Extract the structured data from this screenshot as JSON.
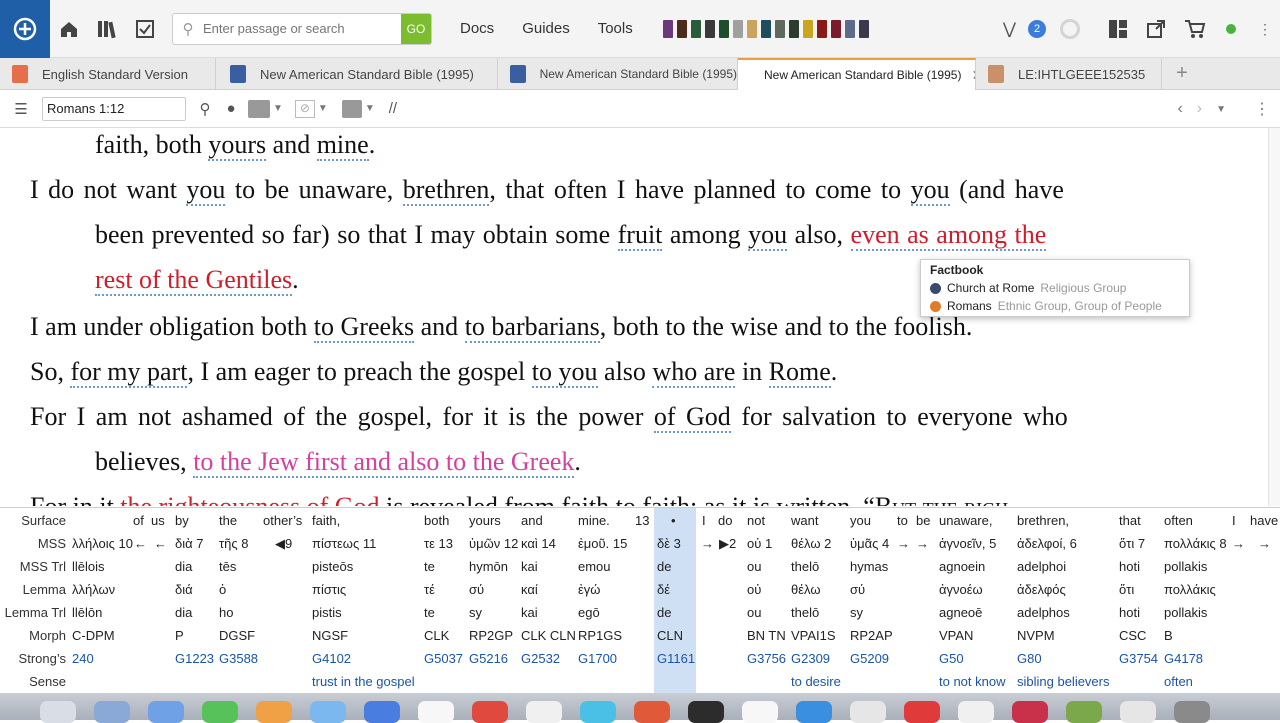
{
  "topbar": {
    "search_placeholder": "Enter passage or search",
    "go_label": "GO",
    "menu": [
      "Docs",
      "Guides",
      "Tools"
    ],
    "notification_count": "2",
    "book_colors": [
      "#6b3a7a",
      "#4d2a1a",
      "#2b5c3a",
      "#3a3a3a",
      "#1f4d2b",
      "#a0a0a0",
      "#c9a45a",
      "#1e4d5c",
      "#5e6b5c",
      "#2d3b2d",
      "#c9a520",
      "#8a1a1a",
      "#7a1a2a",
      "#5c6b8a",
      "#3a3a4a"
    ]
  },
  "tabs": [
    {
      "label": "English Standard Version",
      "icon_color": "#e46f4a"
    },
    {
      "label": "New American Standard Bible (1995)",
      "icon_color": "#3a5fa0"
    },
    {
      "label": "New American Standard Bible (1995)",
      "icon_color": "#3a5fa0"
    },
    {
      "label": "New American Standard Bible (1995)",
      "icon_color": "#1f3f7a",
      "active": true
    },
    {
      "label": "LE:IHTLGEEE152535",
      "icon_color": "#c9906a"
    }
  ],
  "toolbar": {
    "reference": "Romans 1:12",
    "parallel_label": "//"
  },
  "text": {
    "l1": [
      "faith, both ",
      "yours",
      " and ",
      "mine",
      "."
    ],
    "l2": [
      "I do not want ",
      "you",
      " to be unaware, ",
      "brethren",
      ", that often I have planned to come to ",
      "you",
      " (and have"
    ],
    "l3": [
      "been prevented so far) so that I may obtain some ",
      "fruit",
      " among ",
      "you",
      " also, ",
      "even as among the"
    ],
    "l4": [
      "rest of the Gentiles",
      "."
    ],
    "l5": [
      "I am under obligation both ",
      "to Greeks",
      " and ",
      "to barbarians",
      ", both to the wise and to the foolish."
    ],
    "l6": [
      "So, ",
      "for my part",
      ", I am eager to preach the gospel ",
      "to you",
      " also ",
      "who are",
      " in ",
      "Rome",
      "."
    ],
    "l7": [
      "For I am not ashamed of the gospel, for it is the power ",
      "of God",
      " for salvation to everyone who"
    ],
    "l8": [
      "believes, ",
      "to the Jew first and also to the Greek",
      "."
    ],
    "l9": [
      "For in it ",
      "the righteousness of God",
      " is revealed from faith to faith; as it is written, “",
      "But the righ"
    ]
  },
  "factbook": {
    "title": "Factbook",
    "items": [
      {
        "name": "Church at Rome",
        "type": "Religious Group",
        "color": "#3a4a6a"
      },
      {
        "name": "Romans",
        "type": "Ethnic Group, Group of People",
        "color": "#e07b2a"
      }
    ]
  },
  "interlinear": {
    "row_labels": [
      "Surface",
      "MSS",
      "MSS Trl",
      "Lemma",
      "Lemma Trl",
      "Morph",
      "Strong’s",
      "Sense"
    ],
    "surface": [
      "of",
      "us",
      "by",
      "the",
      "other’s",
      "faith,",
      "both",
      "yours",
      "and",
      "mine.",
      "13",
      "•",
      "I",
      "do",
      "not",
      "want",
      "you",
      "to",
      "be",
      "unaware,",
      "brethren,",
      "that",
      "often",
      "I",
      "have"
    ],
    "mss": [
      "λλήλοις 10",
      "←",
      "←",
      "διὰ 7",
      "τῆς 8",
      "◀9",
      "πίστεως 11",
      "τε 13",
      "ὑμῶν 12",
      "καὶ 14",
      "ἐμοῦ. 15",
      "δὲ 3",
      "→",
      "▶2",
      "οὐ 1",
      "θέλω 2",
      "ὑμᾶς 4",
      "→",
      "→",
      "ἀγνοεῖν, 5",
      "ἀδελφοί, 6",
      "ὅτι 7",
      "πολλάκις 8",
      "→",
      "→"
    ],
    "mss_trl": [
      "llēlois",
      "dia",
      "tēs",
      "pisteōs",
      "te",
      "hymōn",
      "kai",
      "emou",
      "de",
      "ou",
      "thelō",
      "hymas",
      "agnoein",
      "adelphoi",
      "hoti",
      "pollakis"
    ],
    "lemma": [
      "λλήλων",
      "διά",
      "ὁ",
      "πίστις",
      "τέ",
      "σύ",
      "καί",
      "ἐγώ",
      "δέ",
      "οὐ",
      "θέλω",
      "σύ",
      "ἀγνοέω",
      "ἀδελφός",
      "ὅτι",
      "πολλάκις"
    ],
    "lemma_trl": [
      "llēlōn",
      "dia",
      "ho",
      "pistis",
      "te",
      "sy",
      "kai",
      "egō",
      "de",
      "ou",
      "thelō",
      "sy",
      "agneoē",
      "adelphos",
      "hoti",
      "pollakis"
    ],
    "morph": [
      "C-DPM",
      "P",
      "DGSF",
      "NGSF",
      "CLK",
      "RP2GP",
      "CLK CLN",
      "RP1GS",
      "CLN",
      "BN TN",
      "VPAI1S",
      "RP2AP",
      "VPAN",
      "NVPM",
      "CSC",
      "B"
    ],
    "strongs": [
      "240",
      "G1223",
      "G3588",
      "G4102",
      "G5037",
      "G5216",
      "G2532",
      "G1700",
      "G1161",
      "G3756",
      "G2309",
      "G5209",
      "G50",
      "G80",
      "G3754",
      "G4178"
    ],
    "sense": [
      "trust in the gospel",
      "to desire",
      "to not know",
      "sibling believers",
      "often"
    ]
  }
}
